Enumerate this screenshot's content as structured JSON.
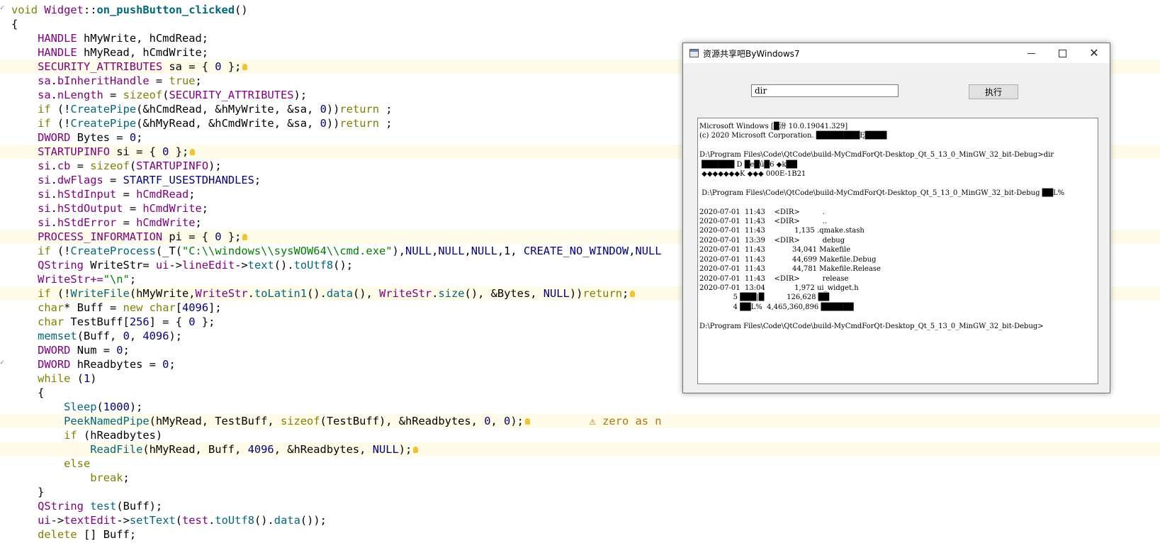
{
  "editor": {
    "lines": [
      [
        {
          "t": "void ",
          "c": "kw"
        },
        {
          "t": "Widget",
          "c": "ty"
        },
        {
          "t": "::"
        },
        {
          "t": "on_pushButton_clicked",
          "c": "fnb"
        },
        {
          "t": "()"
        }
      ],
      [
        {
          "t": "{"
        }
      ],
      [
        {
          "t": "    "
        },
        {
          "t": "HANDLE",
          "c": "ty"
        },
        {
          "t": " hMyWrite, hCmdRead;"
        }
      ],
      [
        {
          "t": "    "
        },
        {
          "t": "HANDLE",
          "c": "ty"
        },
        {
          "t": " hMyRead, hCmdWrite;"
        }
      ],
      [
        {
          "t": "    "
        },
        {
          "t": "SECURITY_ATTRIBUTES",
          "c": "ty"
        },
        {
          "t": " sa = { "
        },
        {
          "t": "0",
          "c": "num"
        },
        {
          "t": " };"
        }
      ],
      [
        {
          "t": "    "
        },
        {
          "t": "sa",
          "c": "ty"
        },
        {
          "t": "."
        },
        {
          "t": "bInheritHandle",
          "c": "ty"
        },
        {
          "t": " = "
        },
        {
          "t": "true",
          "c": "kw"
        },
        {
          "t": ";"
        }
      ],
      [
        {
          "t": "    "
        },
        {
          "t": "sa",
          "c": "ty"
        },
        {
          "t": "."
        },
        {
          "t": "nLength",
          "c": "ty"
        },
        {
          "t": " = "
        },
        {
          "t": "sizeof",
          "c": "kw"
        },
        {
          "t": "("
        },
        {
          "t": "SECURITY_ATTRIBUTES",
          "c": "ty"
        },
        {
          "t": ");"
        }
      ],
      [
        {
          "t": "    "
        },
        {
          "t": "if",
          "c": "kw"
        },
        {
          "t": " (!"
        },
        {
          "t": "CreatePipe",
          "c": "fn"
        },
        {
          "t": "(&hCmdRead, &hMyWrite, &sa, "
        },
        {
          "t": "0",
          "c": "num"
        },
        {
          "t": "))"
        },
        {
          "t": "return",
          "c": "kw"
        },
        {
          "t": " ;"
        }
      ],
      [
        {
          "t": "    "
        },
        {
          "t": "if",
          "c": "kw"
        },
        {
          "t": " (!"
        },
        {
          "t": "CreatePipe",
          "c": "fn"
        },
        {
          "t": "(&hMyRead, &hCmdWrite, &sa, "
        },
        {
          "t": "0",
          "c": "num"
        },
        {
          "t": "))"
        },
        {
          "t": "return",
          "c": "kw"
        },
        {
          "t": " ;"
        }
      ],
      [
        {
          "t": "    "
        },
        {
          "t": "DWORD",
          "c": "ty"
        },
        {
          "t": " Bytes = "
        },
        {
          "t": "0",
          "c": "num"
        },
        {
          "t": ";"
        }
      ],
      [
        {
          "t": "    "
        },
        {
          "t": "STARTUPINFO",
          "c": "ty"
        },
        {
          "t": " si = { "
        },
        {
          "t": "0",
          "c": "num"
        },
        {
          "t": " };"
        }
      ],
      [
        {
          "t": "    "
        },
        {
          "t": "si",
          "c": "ty"
        },
        {
          "t": "."
        },
        {
          "t": "cb",
          "c": "ty"
        },
        {
          "t": " = "
        },
        {
          "t": "sizeof",
          "c": "kw"
        },
        {
          "t": "("
        },
        {
          "t": "STARTUPINFO",
          "c": "ty"
        },
        {
          "t": ");"
        }
      ],
      [
        {
          "t": "    "
        },
        {
          "t": "si",
          "c": "ty"
        },
        {
          "t": "."
        },
        {
          "t": "dwFlags",
          "c": "ty"
        },
        {
          "t": " = "
        },
        {
          "t": "STARTF_USESTDHANDLES",
          "c": "mac"
        },
        {
          "t": ";"
        }
      ],
      [
        {
          "t": "    "
        },
        {
          "t": "si",
          "c": "ty"
        },
        {
          "t": "."
        },
        {
          "t": "hStdInput",
          "c": "ty"
        },
        {
          "t": " = "
        },
        {
          "t": "hCmdRead",
          "c": "ty"
        },
        {
          "t": ";"
        }
      ],
      [
        {
          "t": "    "
        },
        {
          "t": "si",
          "c": "ty"
        },
        {
          "t": "."
        },
        {
          "t": "hStdOutput",
          "c": "ty"
        },
        {
          "t": " = "
        },
        {
          "t": "hCmdWrite",
          "c": "ty"
        },
        {
          "t": ";"
        }
      ],
      [
        {
          "t": "    "
        },
        {
          "t": "si",
          "c": "ty"
        },
        {
          "t": "."
        },
        {
          "t": "hStdError",
          "c": "ty"
        },
        {
          "t": " = "
        },
        {
          "t": "hCmdWrite",
          "c": "ty"
        },
        {
          "t": ";"
        }
      ],
      [
        {
          "t": "    "
        },
        {
          "t": "PROCESS_INFORMATION",
          "c": "ty"
        },
        {
          "t": " pi = { "
        },
        {
          "t": "0",
          "c": "num"
        },
        {
          "t": " };"
        }
      ],
      [
        {
          "t": "    "
        },
        {
          "t": "if",
          "c": "kw"
        },
        {
          "t": " (!"
        },
        {
          "t": "CreateProcess",
          "c": "fn"
        },
        {
          "t": "(_T("
        },
        {
          "t": "\"C:\\\\windows\\\\sysWOW64\\\\cmd.exe\"",
          "c": "str"
        },
        {
          "t": "),"
        },
        {
          "t": "NULL",
          "c": "mac"
        },
        {
          "t": ","
        },
        {
          "t": "NULL",
          "c": "mac"
        },
        {
          "t": ","
        },
        {
          "t": "NULL",
          "c": "mac"
        },
        {
          "t": ",1, "
        },
        {
          "t": "CREATE_NO_WINDOW",
          "c": "mac"
        },
        {
          "t": ","
        },
        {
          "t": "NULL",
          "c": "mac"
        }
      ],
      [
        {
          "t": "    "
        },
        {
          "t": "QString",
          "c": "ty"
        },
        {
          "t": " WriteStr= "
        },
        {
          "t": "ui",
          "c": "ty"
        },
        {
          "t": "->"
        },
        {
          "t": "lineEdit",
          "c": "ty"
        },
        {
          "t": "->"
        },
        {
          "t": "text",
          "c": "fn"
        },
        {
          "t": "()."
        },
        {
          "t": "toUtf8",
          "c": "fn"
        },
        {
          "t": "();"
        }
      ],
      [
        {
          "t": "    "
        },
        {
          "t": "WriteStr+=",
          "c": "ty"
        },
        {
          "t": "\"\\n\"",
          "c": "str"
        },
        {
          "t": ";"
        }
      ],
      [
        {
          "t": "    "
        },
        {
          "t": "if",
          "c": "kw"
        },
        {
          "t": " (!"
        },
        {
          "t": "WriteFile",
          "c": "fn"
        },
        {
          "t": "(hMyWrite,"
        },
        {
          "t": "WriteStr",
          "c": "ty"
        },
        {
          "t": "."
        },
        {
          "t": "toLatin1",
          "c": "fn"
        },
        {
          "t": "()."
        },
        {
          "t": "data",
          "c": "fn"
        },
        {
          "t": "(), "
        },
        {
          "t": "WriteStr",
          "c": "ty"
        },
        {
          "t": "."
        },
        {
          "t": "size",
          "c": "fn"
        },
        {
          "t": "(), &Bytes, "
        },
        {
          "t": "NULL",
          "c": "mac"
        },
        {
          "t": "))"
        },
        {
          "t": "return",
          "c": "kw"
        },
        {
          "t": ";"
        }
      ],
      [
        {
          "t": "    "
        },
        {
          "t": "char",
          "c": "kw"
        },
        {
          "t": "* Buff = "
        },
        {
          "t": "new",
          "c": "kw"
        },
        {
          "t": " "
        },
        {
          "t": "char",
          "c": "kw"
        },
        {
          "t": "["
        },
        {
          "t": "4096",
          "c": "num"
        },
        {
          "t": "];"
        }
      ],
      [
        {
          "t": "    "
        },
        {
          "t": "char",
          "c": "kw"
        },
        {
          "t": " TestBuff["
        },
        {
          "t": "256",
          "c": "num"
        },
        {
          "t": "] = { "
        },
        {
          "t": "0",
          "c": "num"
        },
        {
          "t": " };"
        }
      ],
      [
        {
          "t": "    "
        },
        {
          "t": "memset",
          "c": "fn"
        },
        {
          "t": "(Buff, "
        },
        {
          "t": "0",
          "c": "num"
        },
        {
          "t": ", "
        },
        {
          "t": "4096",
          "c": "num"
        },
        {
          "t": ");"
        }
      ],
      [
        {
          "t": "    "
        },
        {
          "t": "DWORD",
          "c": "ty"
        },
        {
          "t": " Num = "
        },
        {
          "t": "0",
          "c": "num"
        },
        {
          "t": ";"
        }
      ],
      [
        {
          "t": "    "
        },
        {
          "t": "DWORD",
          "c": "ty"
        },
        {
          "t": " hReadbytes = "
        },
        {
          "t": "0",
          "c": "num"
        },
        {
          "t": ";"
        }
      ],
      [
        {
          "t": "    "
        },
        {
          "t": "while",
          "c": "kw"
        },
        {
          "t": " ("
        },
        {
          "t": "1",
          "c": "num"
        },
        {
          "t": ")"
        }
      ],
      [
        {
          "t": "    {"
        }
      ],
      [
        {
          "t": "        "
        },
        {
          "t": "Sleep",
          "c": "fn"
        },
        {
          "t": "("
        },
        {
          "t": "1000",
          "c": "num"
        },
        {
          "t": ");"
        }
      ],
      [
        {
          "t": "        "
        },
        {
          "t": "PeekNamedPipe",
          "c": "fn"
        },
        {
          "t": "(hMyRead, TestBuff, "
        },
        {
          "t": "sizeof",
          "c": "kw"
        },
        {
          "t": "(TestBuff), &hReadbytes, "
        },
        {
          "t": "0",
          "c": "num"
        },
        {
          "t": ", "
        },
        {
          "t": "0",
          "c": "num"
        },
        {
          "t": ");"
        }
      ],
      [
        {
          "t": "        "
        },
        {
          "t": "if",
          "c": "kw"
        },
        {
          "t": " (hReadbytes)"
        }
      ],
      [
        {
          "t": "            "
        },
        {
          "t": "ReadFile",
          "c": "fn"
        },
        {
          "t": "(hMyRead, Buff, "
        },
        {
          "t": "4096",
          "c": "num"
        },
        {
          "t": ", &hReadbytes, "
        },
        {
          "t": "NULL",
          "c": "mac"
        },
        {
          "t": ");"
        }
      ],
      [
        {
          "t": "        "
        },
        {
          "t": "else",
          "c": "kw"
        }
      ],
      [
        {
          "t": "            "
        },
        {
          "t": "break",
          "c": "kw"
        },
        {
          "t": ";"
        }
      ],
      [
        {
          "t": "    }"
        }
      ],
      [
        {
          "t": "    "
        },
        {
          "t": "QString",
          "c": "ty"
        },
        {
          "t": " "
        },
        {
          "t": "test",
          "c": "fn"
        },
        {
          "t": "(Buff);"
        }
      ],
      [
        {
          "t": "    "
        },
        {
          "t": "ui",
          "c": "ty"
        },
        {
          "t": "->"
        },
        {
          "t": "textEdit",
          "c": "ty"
        },
        {
          "t": "->"
        },
        {
          "t": "setText",
          "c": "fn"
        },
        {
          "t": "("
        },
        {
          "t": "test",
          "c": "ty"
        },
        {
          "t": "."
        },
        {
          "t": "toUtf8",
          "c": "fn"
        },
        {
          "t": "()."
        },
        {
          "t": "data",
          "c": "fn"
        },
        {
          "t": "());"
        }
      ],
      [
        {
          "t": "    "
        },
        {
          "t": "delete",
          "c": "kw"
        },
        {
          "t": " [] Buff;"
        }
      ]
    ],
    "warning_text": "⚠ zero as n",
    "highlight_lines": [
      4,
      10,
      16,
      20,
      29,
      31
    ]
  },
  "dialog": {
    "title": "资源共享吧ByWindows7",
    "command_value": "dir",
    "run_label": "执行",
    "output": "Microsoft Windows [█汾 10.0.19041.329]\n(c) 2020 Microsoft Corporation. ████████Ę████\n\nD:\\Program Files\\Code\\QtCode\\build-MyCmdForQt-Desktop_Qt_5_13_0_MinGW_32_bit-Debug>dir\n ██████ D █e█û█6 ◆k██\n ◆◆◆◆◆◆◆K ◆◆◆ 000E-1B21\n\n D:\\Program Files\\Code\\QtCode\\build-MyCmdForQt-Desktop_Qt_5_13_0_MinGW_32_bit-Debug ██L%\n\n2020-07-01  11:43    <DIR>          .\n2020-07-01  11:43    <DIR>          ..\n2020-07-01  11:43             1,135 .qmake.stash\n2020-07-01  13:39    <DIR>          debug\n2020-07-01  11:43            34,041 Makefile\n2020-07-01  11:43            44,699 Makefile.Debug\n2020-07-01  11:43            44,781 Makefile.Release\n2020-07-01  11:43    <DIR>          release\n2020-07-01  13:04             1,972 ui_widget.h\n               5 ███|█          126,628 ██\n               4 ██L%  4,465,360,896 ██████\n\nD:\\Program Files\\Code\\QtCode\\build-MyCmdForQt-Desktop_Qt_5_13_0_MinGW_32_bit-Debug>"
  }
}
